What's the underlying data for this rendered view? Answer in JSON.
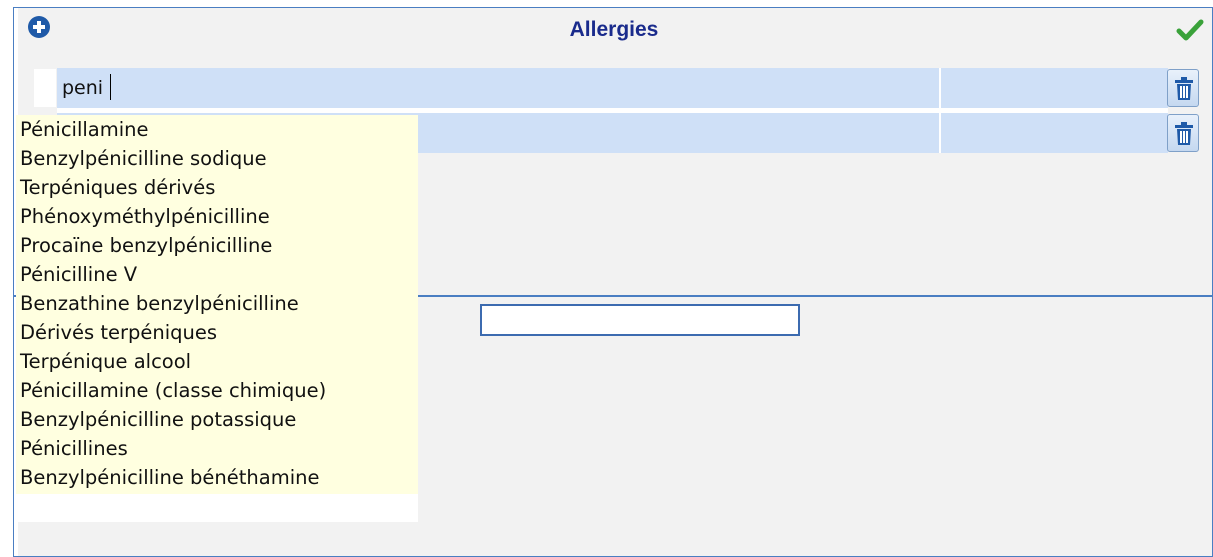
{
  "header": {
    "title": "Allergies",
    "add_icon": "plus-circle-icon",
    "confirm_icon": "checkmark-icon",
    "confirm_color": "#3aa23a"
  },
  "search": {
    "value": "peni"
  },
  "rows": [
    {
      "delete_icon": "trash-icon"
    },
    {
      "delete_icon": "trash-icon"
    }
  ],
  "suggestions": [
    "Pénicillamine",
    "Benzylpénicilline sodique",
    "Terpéniques dérivés",
    "Phénoxyméthylpénicilline",
    "Procaïne benzylpénicilline",
    "Pénicilline V",
    "Benzathine benzylpénicilline",
    "Dérivés terpéniques",
    "Terpénique alcool",
    "Pénicillamine (classe chimique)",
    "Benzylpénicilline potassique",
    "Pénicillines",
    "Benzylpénicilline bénéthamine"
  ],
  "colors": {
    "accent": "#1f5aa8",
    "title": "#1a2b8c",
    "row_bg": "#cfe0f7",
    "dropdown_bg": "#ffffe0",
    "border": "#4a7ec2"
  }
}
